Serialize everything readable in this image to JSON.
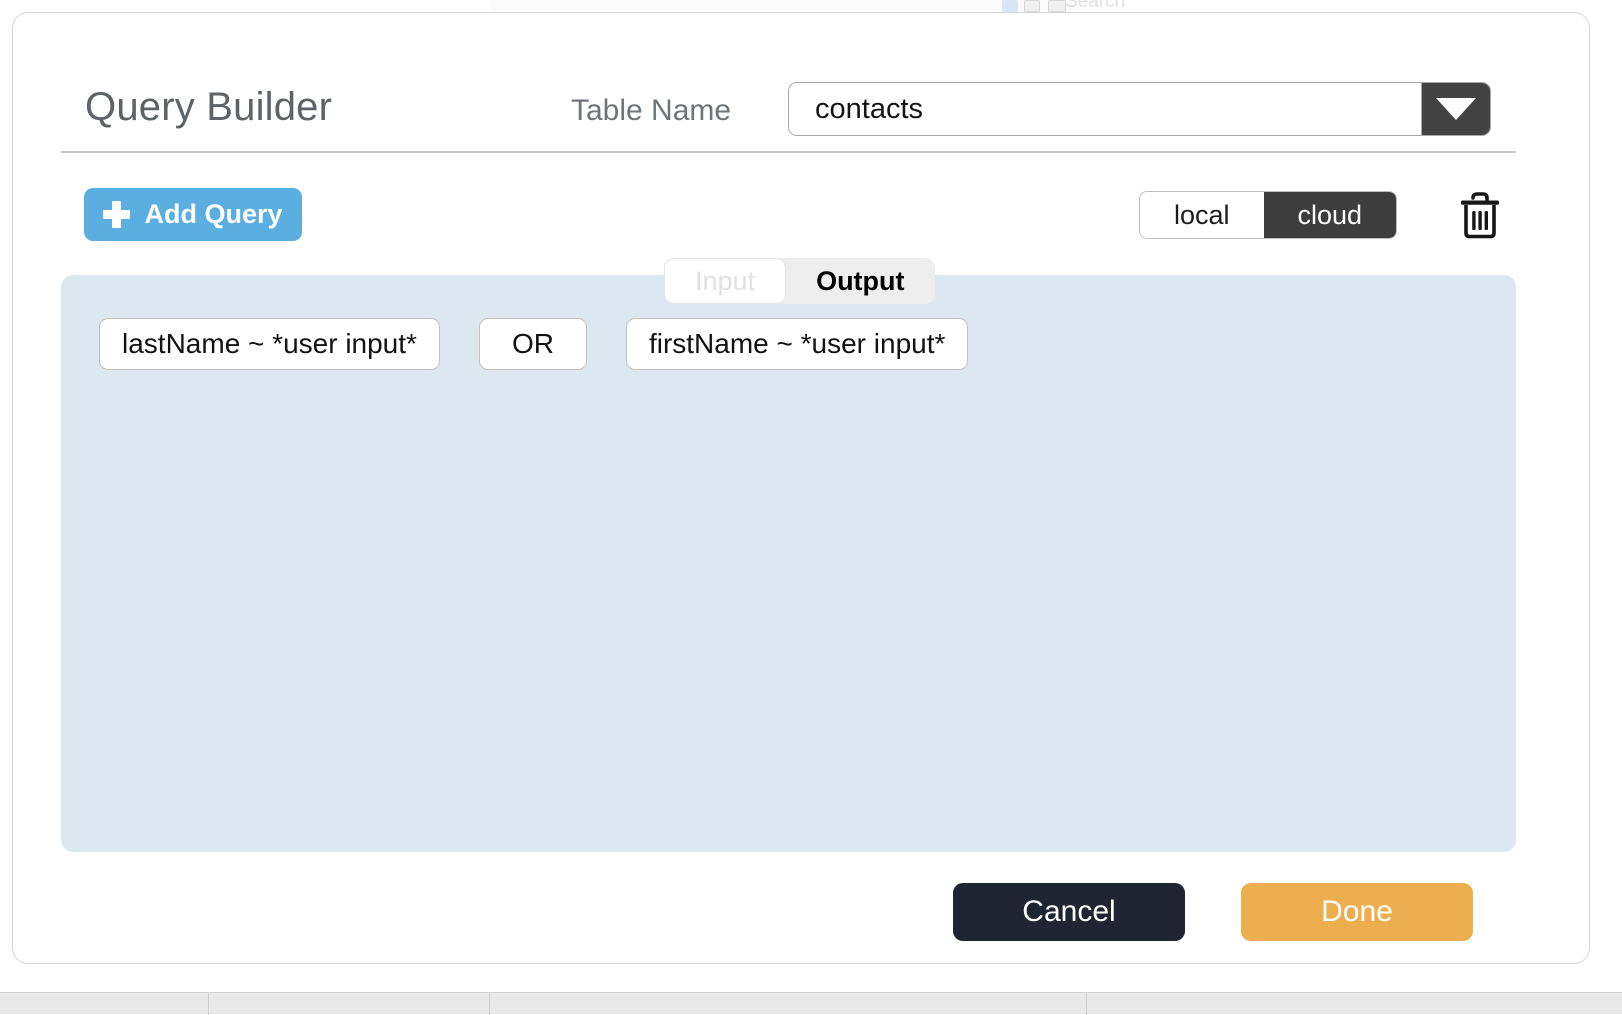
{
  "background": {
    "search_label": "Search"
  },
  "dialog": {
    "title": "Query Builder",
    "table_name": {
      "label": "Table Name",
      "value": "contacts",
      "placeholder": "contacts",
      "dropdown_icon": "chevron-down-icon"
    }
  },
  "toolbar": {
    "add_query_label": "Add Query",
    "add_query_icon": "plus-icon",
    "source_toggle": {
      "options": [
        "local",
        "cloud"
      ],
      "selected": "cloud",
      "local_label": "local",
      "cloud_label": "cloud"
    },
    "delete_icon": "trash-icon"
  },
  "tabs": {
    "items": [
      {
        "label": "Input",
        "state": "disabled"
      },
      {
        "label": "Output",
        "state": "selected"
      }
    ],
    "input_label": "Input",
    "output_label": "Output",
    "selected": "Output"
  },
  "query": {
    "conditions": [
      {
        "type": "condition",
        "text": "lastName ~ *user input*"
      },
      {
        "type": "operator",
        "text": "OR"
      },
      {
        "type": "condition",
        "text": "firstName ~ *user input*"
      }
    ]
  },
  "footer": {
    "cancel_label": "Cancel",
    "done_label": "Done"
  },
  "colors": {
    "accent_blue": "#5aaee0",
    "canvas_blue": "#dce8ef",
    "toggle_active": "#3d3d3d",
    "cancel_dark": "#1f2533",
    "done_orange": "#edae50",
    "title_gray": "#5f6368"
  }
}
